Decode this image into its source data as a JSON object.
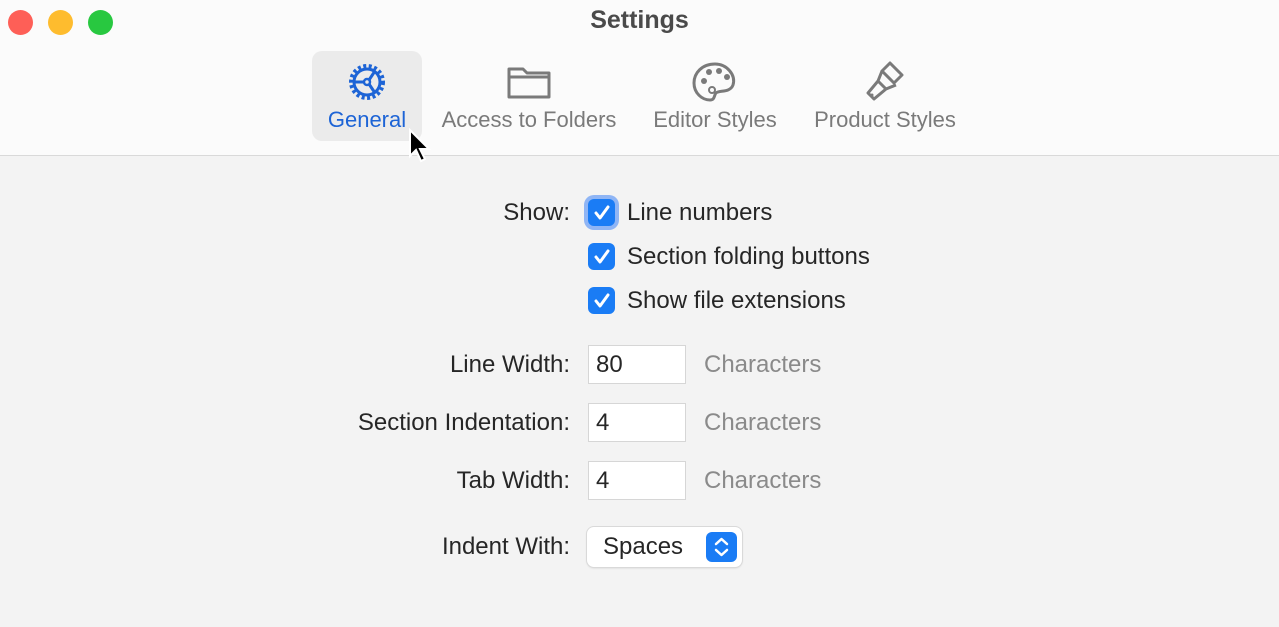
{
  "window": {
    "title": "Settings",
    "traffic_lights": {
      "close": "#fe5f57",
      "minimize": "#febc2e",
      "zoom": "#28c840"
    }
  },
  "toolbar": {
    "tabs": [
      {
        "label": "General",
        "icon": "gear-icon",
        "selected": true
      },
      {
        "label": "Access to Folders",
        "icon": "folder-icon",
        "selected": false
      },
      {
        "label": "Editor Styles",
        "icon": "palette-icon",
        "selected": false
      },
      {
        "label": "Product Styles",
        "icon": "paintbrush-icon",
        "selected": false
      }
    ]
  },
  "general": {
    "show_label": "Show:",
    "checkboxes": [
      {
        "label": "Line numbers",
        "checked": true
      },
      {
        "label": "Section folding buttons",
        "checked": true
      },
      {
        "label": "Show file extensions",
        "checked": true
      }
    ],
    "fields": [
      {
        "label": "Line Width:",
        "value": "80",
        "unit": "Characters"
      },
      {
        "label": "Section Indentation:",
        "value": "4",
        "unit": "Characters"
      },
      {
        "label": "Tab Width:",
        "value": "4",
        "unit": "Characters"
      }
    ],
    "indent_label": "Indent With:",
    "indent_value": "Spaces"
  },
  "colors": {
    "accent": "#1a7cf5",
    "selected_tab": "#1d64d6"
  }
}
